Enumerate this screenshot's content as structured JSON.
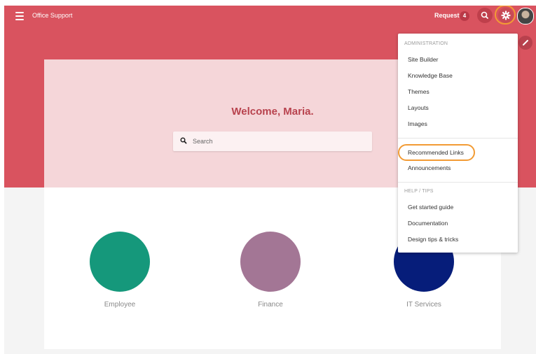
{
  "header": {
    "app_title": "Office Support",
    "requests_label": "Requests",
    "requests_count": "4"
  },
  "hero": {
    "welcome": "Welcome, Maria.",
    "search_placeholder": "Search"
  },
  "categories": [
    {
      "label": "Employee",
      "color": "#15987b"
    },
    {
      "label": "Finance",
      "color": "#a37695"
    },
    {
      "label": "IT Services",
      "color": "#061d7a"
    }
  ],
  "menu": {
    "admin_title": "ADMINISTRATION",
    "admin_items": [
      "Site Builder",
      "Knowledge Base",
      "Themes",
      "Layouts",
      "Images"
    ],
    "links_items": [
      "Recommended Links",
      "Announcements"
    ],
    "help_title": "HELP / TIPS",
    "help_items": [
      "Get started guide",
      "Documentation",
      "Design tips & tricks"
    ]
  },
  "colors": {
    "brand": "#d9535f",
    "hero_card": "#f5d6d9",
    "highlight": "#f29b34"
  },
  "icons": [
    "menu-icon",
    "search-icon",
    "gear-icon",
    "avatar",
    "pencil-icon"
  ]
}
